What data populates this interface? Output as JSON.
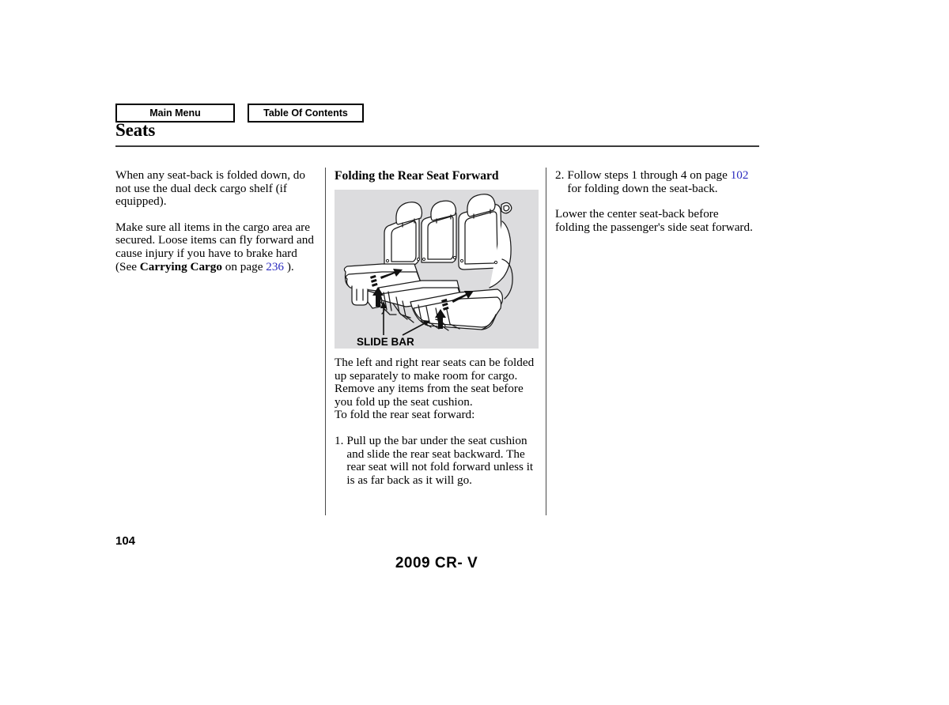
{
  "nav": {
    "main_menu": "Main Menu",
    "table_of_contents": "Table Of Contents"
  },
  "header": {
    "title": "Seats"
  },
  "columns": {
    "left": {
      "paragraph1": "When any seat-back is folded down, do not use the dual deck cargo shelf (if equipped).",
      "paragraph2_part1": "Make sure all items in the cargo area are secured. Loose items can fly forward and cause injury if you have to brake hard (See ",
      "paragraph2_bold": "Carrying Cargo",
      "paragraph2_part2": " on page ",
      "paragraph2_link": "236",
      "paragraph2_part3": " )."
    },
    "middle": {
      "subheading": "Folding the Rear Seat Forward",
      "figure_label": "SLIDE BAR",
      "paragraph1": "The left and right rear seats can be folded up separately to make room for cargo.",
      "paragraph2": "Remove any items from the seat before you fold up the seat cushion.",
      "paragraph3": "To fold the rear seat forward:",
      "step1_number": "1.",
      "step1_text": "Pull up the bar under the seat cushion and slide the rear seat backward. The rear seat will not fold forward unless it is as far back as it will go."
    },
    "right": {
      "step2_number": "2.",
      "step2_part1": "Follow steps 1 through 4 on page ",
      "step2_link": "102",
      "step2_part2": " for folding down the seat-back.",
      "paragraph1": "Lower the center seat-back before folding the passenger's side seat forward."
    }
  },
  "footer": {
    "page_number": "104",
    "model": "2009 CR- V"
  },
  "colors": {
    "link": "#2b2bbf",
    "figure_background": "#dcdcde",
    "rule": "#3b3b3b"
  }
}
